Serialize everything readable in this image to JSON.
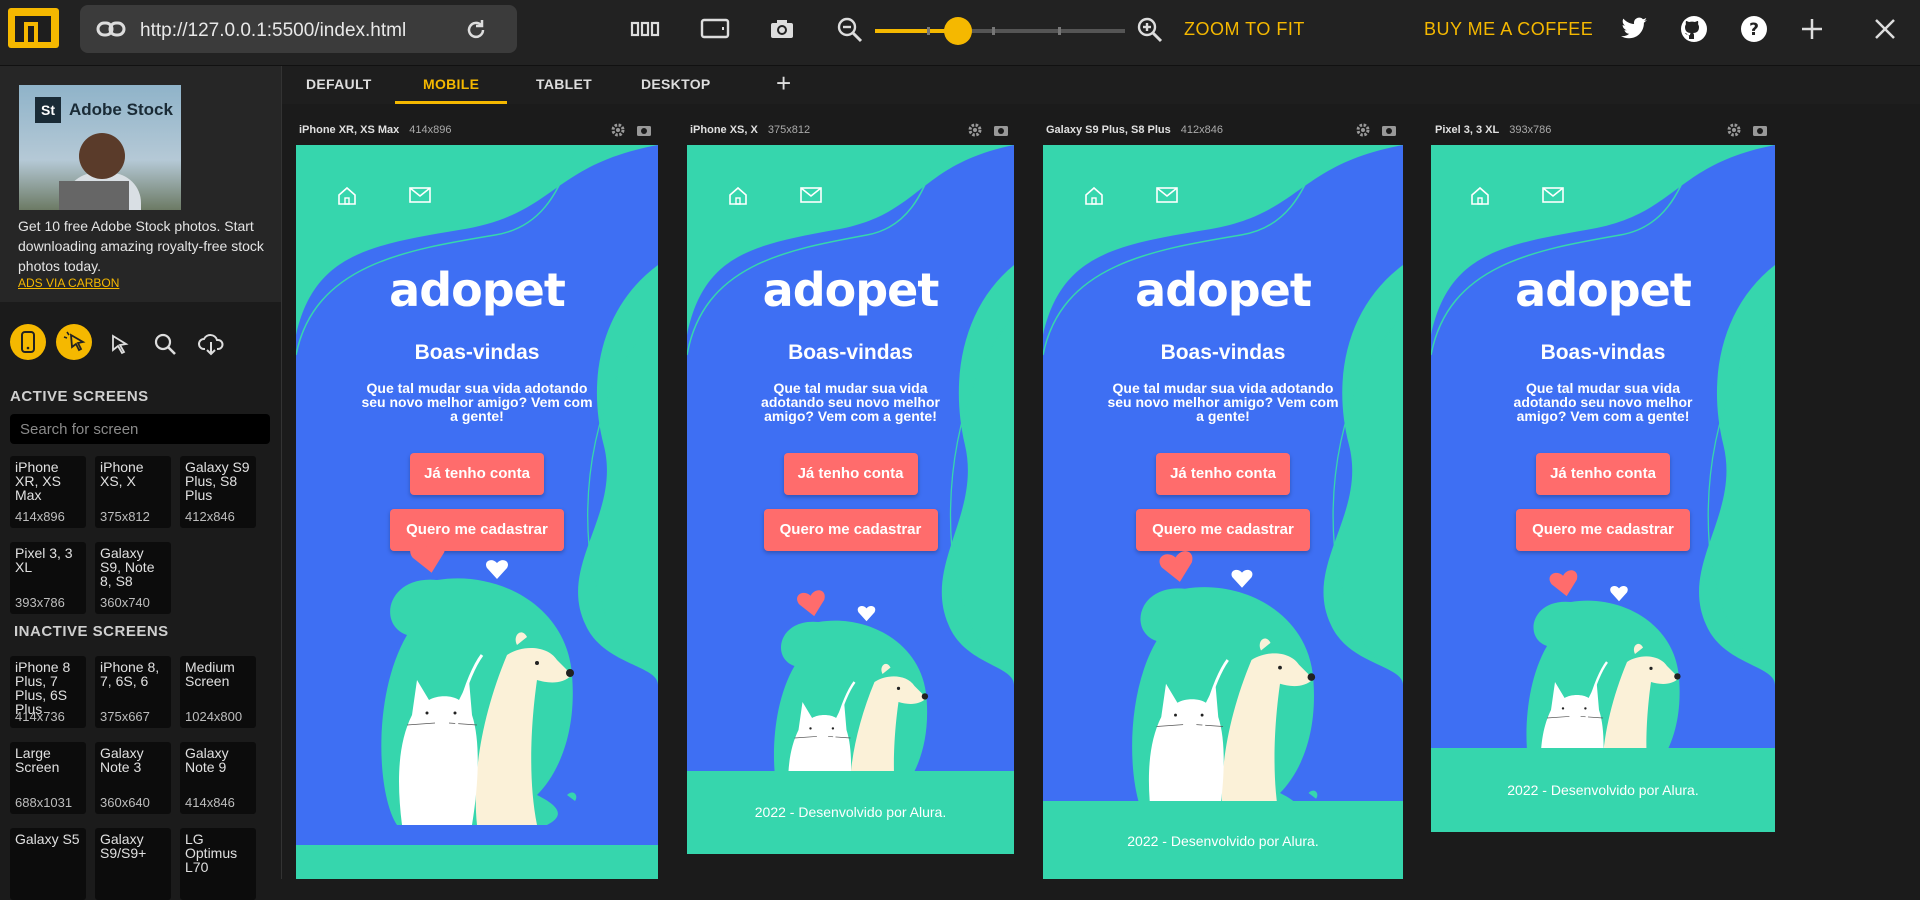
{
  "topbar": {
    "url": "http://127.0.0.1:5500/index.html",
    "zoom_to_fit": "ZOOM TO FIT",
    "buy_coffee": "BUY ME A COFFEE",
    "zoom_level": 0.33
  },
  "ad": {
    "brand": "Adobe Stock",
    "brand_icon": "St",
    "text": "Get 10 free Adobe Stock photos. Start downloading amazing royalty-free stock photos today.",
    "link": "ADS VIA CARBON"
  },
  "sidebar": {
    "active_title": "ACTIVE SCREENS",
    "search_placeholder": "Search for screen",
    "inactive_title": "INACTIVE SCREENS",
    "active_screens": [
      {
        "name": "iPhone XR, XS Max",
        "size": "414x896"
      },
      {
        "name": "iPhone XS, X",
        "size": "375x812"
      },
      {
        "name": "Galaxy S9 Plus, S8 Plus",
        "size": "412x846"
      },
      {
        "name": "Pixel 3, 3 XL",
        "size": "393x786"
      },
      {
        "name": "Galaxy S9, Note 8, S8",
        "size": "360x740"
      }
    ],
    "inactive_screens": [
      {
        "name": "iPhone 8 Plus, 7 Plus, 6S Plus",
        "size": "414x736"
      },
      {
        "name": "iPhone 8, 7, 6S, 6",
        "size": "375x667"
      },
      {
        "name": "Medium Screen",
        "size": "1024x800"
      },
      {
        "name": "Large Screen",
        "size": "688x1031"
      },
      {
        "name": "Galaxy Note 3",
        "size": "360x640"
      },
      {
        "name": "Galaxy Note 9",
        "size": "414x846"
      },
      {
        "name": "Galaxy S5",
        "size": ""
      },
      {
        "name": "Galaxy S9/S9+",
        "size": ""
      },
      {
        "name": "LG Optimus L70",
        "size": ""
      }
    ]
  },
  "tabs": [
    "DEFAULT",
    "MOBILE",
    "TABLET",
    "DESKTOP"
  ],
  "devices": [
    {
      "name": "iPhone XR, XS Max",
      "size": "414x896"
    },
    {
      "name": "iPhone XS, X",
      "size": "375x812"
    },
    {
      "name": "Galaxy S9 Plus, S8 Plus",
      "size": "412x846"
    },
    {
      "name": "Pixel 3, 3 XL",
      "size": "393x786"
    }
  ],
  "site": {
    "logo": "adopet",
    "welcome": "Boas-vindas",
    "intro_lines": [
      "Que tal mudar sua vida adotando",
      "seu novo melhor amigo? Vem com",
      "a gente!"
    ],
    "intro_lines_narrow": [
      "Que tal mudar sua vida",
      "adotando seu novo melhor",
      "amigo? Vem com a gente!"
    ],
    "btn_login": "Já tenho conta",
    "btn_signup": "Quero me cadastrar",
    "footer": "2022 - Desenvolvido por Alura."
  },
  "colors": {
    "accent": "#f5b800",
    "site_blue": "#3e6ff3",
    "site_green": "#36d6ad",
    "site_button": "#ff6c6c"
  }
}
